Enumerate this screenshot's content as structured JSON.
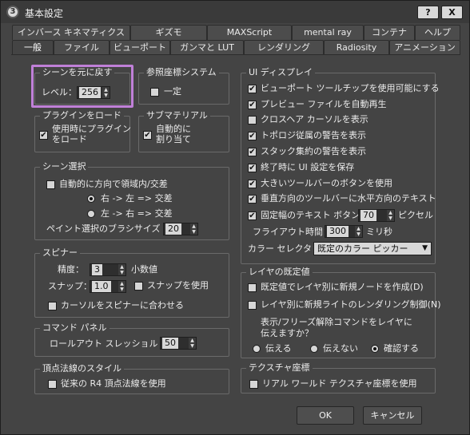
{
  "window": {
    "title": "基本設定",
    "help_label": "?",
    "close_label": "X",
    "app_icon": "3ds-max-icon"
  },
  "tabs_row1": [
    "インバース キネマティクス",
    "ギズモ",
    "MAXScript",
    "mental ray",
    "コンテナ",
    "ヘルプ"
  ],
  "tabs_row2": [
    "一般",
    "ファイル",
    "ビューポート",
    "ガンマと LUT",
    "レンダリング",
    "Radiosity",
    "アニメーション"
  ],
  "active_tab": "一般",
  "undo": {
    "title": "シーンを元に戻す",
    "level_label": "レベル：",
    "level_value": "256"
  },
  "ref_coord": {
    "title": "参照座標システム",
    "const_label": "一定",
    "const_checked": false
  },
  "plugin": {
    "title": "プラグインをロード",
    "line1": "使用時にプラグイン",
    "line2": "をロード",
    "checked": true
  },
  "submat": {
    "title": "サブマテリアル",
    "line1": "自動的に",
    "line2": "割り当て",
    "checked": true
  },
  "scene_sel": {
    "title": "シーン選択",
    "auto_dir_label": "自動的に方向で領域内/交差",
    "auto_dir_checked": false,
    "opt1": "右 -> 左 => 交差",
    "opt2": "左 -> 右 => 交差",
    "opt1_on": true,
    "paint_label": "ペイント選択のブラシサイズ",
    "paint_value": "20"
  },
  "spinner": {
    "title": "スピナー",
    "precision_label": "精度：",
    "precision_value": "3",
    "decimals_label": "小数値",
    "snap_label": "スナップ：",
    "snap_value": "1.0",
    "use_snap_label": "スナップを使用",
    "use_snap_checked": false,
    "cursor_label": "カーソルをスピナーに合わせる",
    "cursor_checked": false
  },
  "cmd_panel": {
    "title": "コマンド パネル",
    "rollout_label": "ロールアウト スレッショルド：",
    "rollout_value": "50"
  },
  "vertex": {
    "title": "頂点法線のスタイル",
    "legacy_label": "従来の R4 頂点法線を使用",
    "legacy_checked": false
  },
  "ui_display": {
    "title": "UI ディスプレイ",
    "items": [
      {
        "label": "ビューポート ツールチップを使用可能にする",
        "checked": true
      },
      {
        "label": "プレビュー ファイルを自動再生",
        "checked": true
      },
      {
        "label": "クロスヘア カーソルを表示",
        "checked": false
      },
      {
        "label": "トポロジ従属の警告を表示",
        "checked": true
      },
      {
        "label": "スタック集約の警告を表示",
        "checked": true
      },
      {
        "label": "終了時に UI 設定を保存",
        "checked": true
      },
      {
        "label": "大きいツールバーのボタンを使用",
        "checked": true
      },
      {
        "label": "垂直方向のツールバーに水平方向のテキスト",
        "checked": true
      }
    ],
    "fixed_width_label": "固定幅のテキスト ボタン:",
    "fixed_width_checked": true,
    "fixed_width_value": "70",
    "pixel_label": "ピクセル",
    "flyout_label": "フライアウト時間：",
    "flyout_value": "300",
    "ms_label": "ミリ秒",
    "color_sel_label": "カラー セレクタ：",
    "color_sel_value": "既定のカラー ピッカー"
  },
  "layer": {
    "title": "レイヤの既定値",
    "opt1": "既定値でレイヤ別に新規ノードを作成(D)",
    "opt1_checked": false,
    "opt2": "レイヤ別に新規ライトのレンダリング制御(N)",
    "opt2_checked": false,
    "q1": "表示/フリーズ解除コマンドをレイヤに",
    "q2": "伝えますか？",
    "r1": "伝える",
    "r2": "伝えない",
    "r3": "確認する",
    "selected": "確認する"
  },
  "texture": {
    "title": "テクスチャ座標",
    "label": "リアル ワールド テクスチャ座標を使用",
    "checked": false
  },
  "buttons": {
    "ok": "OK",
    "cancel": "キャンセル"
  }
}
